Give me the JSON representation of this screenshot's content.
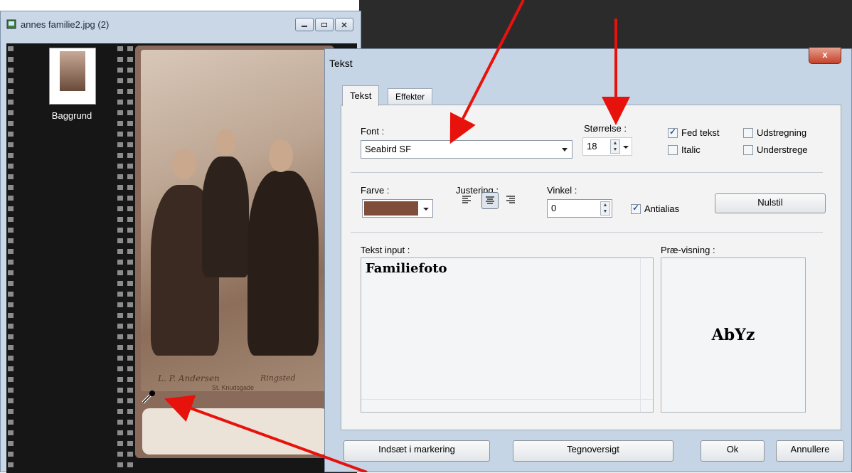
{
  "image_window": {
    "title": "annes familie2.jpg (2)",
    "layer_label": "Baggrund",
    "signature_line1": "L. P. Andersen",
    "signature_line2": "Ringsted",
    "signature_line3": "St. Knudsgade"
  },
  "dialog": {
    "title": "Tekst",
    "close_glyph": "x",
    "tabs": [
      "Tekst",
      "Effekter"
    ],
    "font_label": "Font :",
    "font_value": "Seabird SF",
    "size_label": "Størrelse :",
    "size_value": "18",
    "bold_label": "Fed tekst",
    "italic_label": "Italic",
    "strike_label": "Udstregning",
    "underline_label": "Understrege",
    "color_label": "Farve :",
    "color_value": "#7e4e3a",
    "align_label": "Justering :",
    "angle_label": "Vinkel :",
    "angle_value": "0",
    "antialias_label": "Antialias",
    "reset_button": "Nulstil",
    "text_input_label": "Tekst input :",
    "text_input_value": "Familiefoto",
    "preview_label": "Præ-visning :",
    "preview_text": "AbYz",
    "insert_button": "Indsæt i markering",
    "charmap_button": "Tegnoversigt",
    "ok_button": "Ok",
    "cancel_button": "Annullere",
    "checked": {
      "bold": true,
      "italic": false,
      "strike": false,
      "underline": false,
      "antialias": true
    }
  },
  "annotation_color": "#e8120c"
}
